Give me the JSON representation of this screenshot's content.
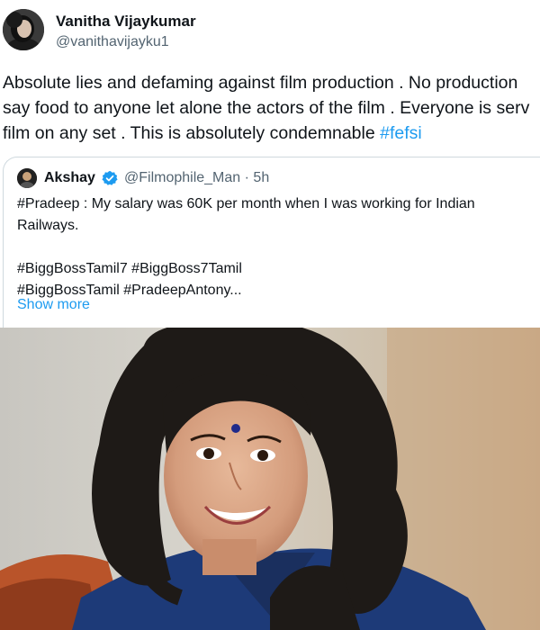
{
  "tweet": {
    "author_name": "Vanitha Vijaykumar",
    "author_handle": "@vanithavijayku1",
    "text_lines": [
      "Absolute lies and defaming against film production . No production",
      "say food to anyone let alone the actors of the film . Everyone is serv",
      "film on any set . This is absolutely condemnable "
    ],
    "hashtag": "#fefsi"
  },
  "quoted_tweet": {
    "author_name": "Akshay",
    "verified": true,
    "author_handle": "@Filmophile_Man",
    "separator": "·",
    "time": "5h",
    "text_lines": [
      "#Pradeep : My salary was 60K per month when I was working for Indian",
      "Railways."
    ],
    "hashtag_lines": [
      "#BiggBossTamil7 #BiggBoss7Tamil",
      "#BiggBossTamil #PradeepAntony..."
    ],
    "show_more": "Show more"
  },
  "icons": {
    "verified": "verified-badge-icon"
  },
  "colors": {
    "link": "#1d9bf0",
    "secondary_text": "#536471",
    "border": "#cfd9de"
  }
}
